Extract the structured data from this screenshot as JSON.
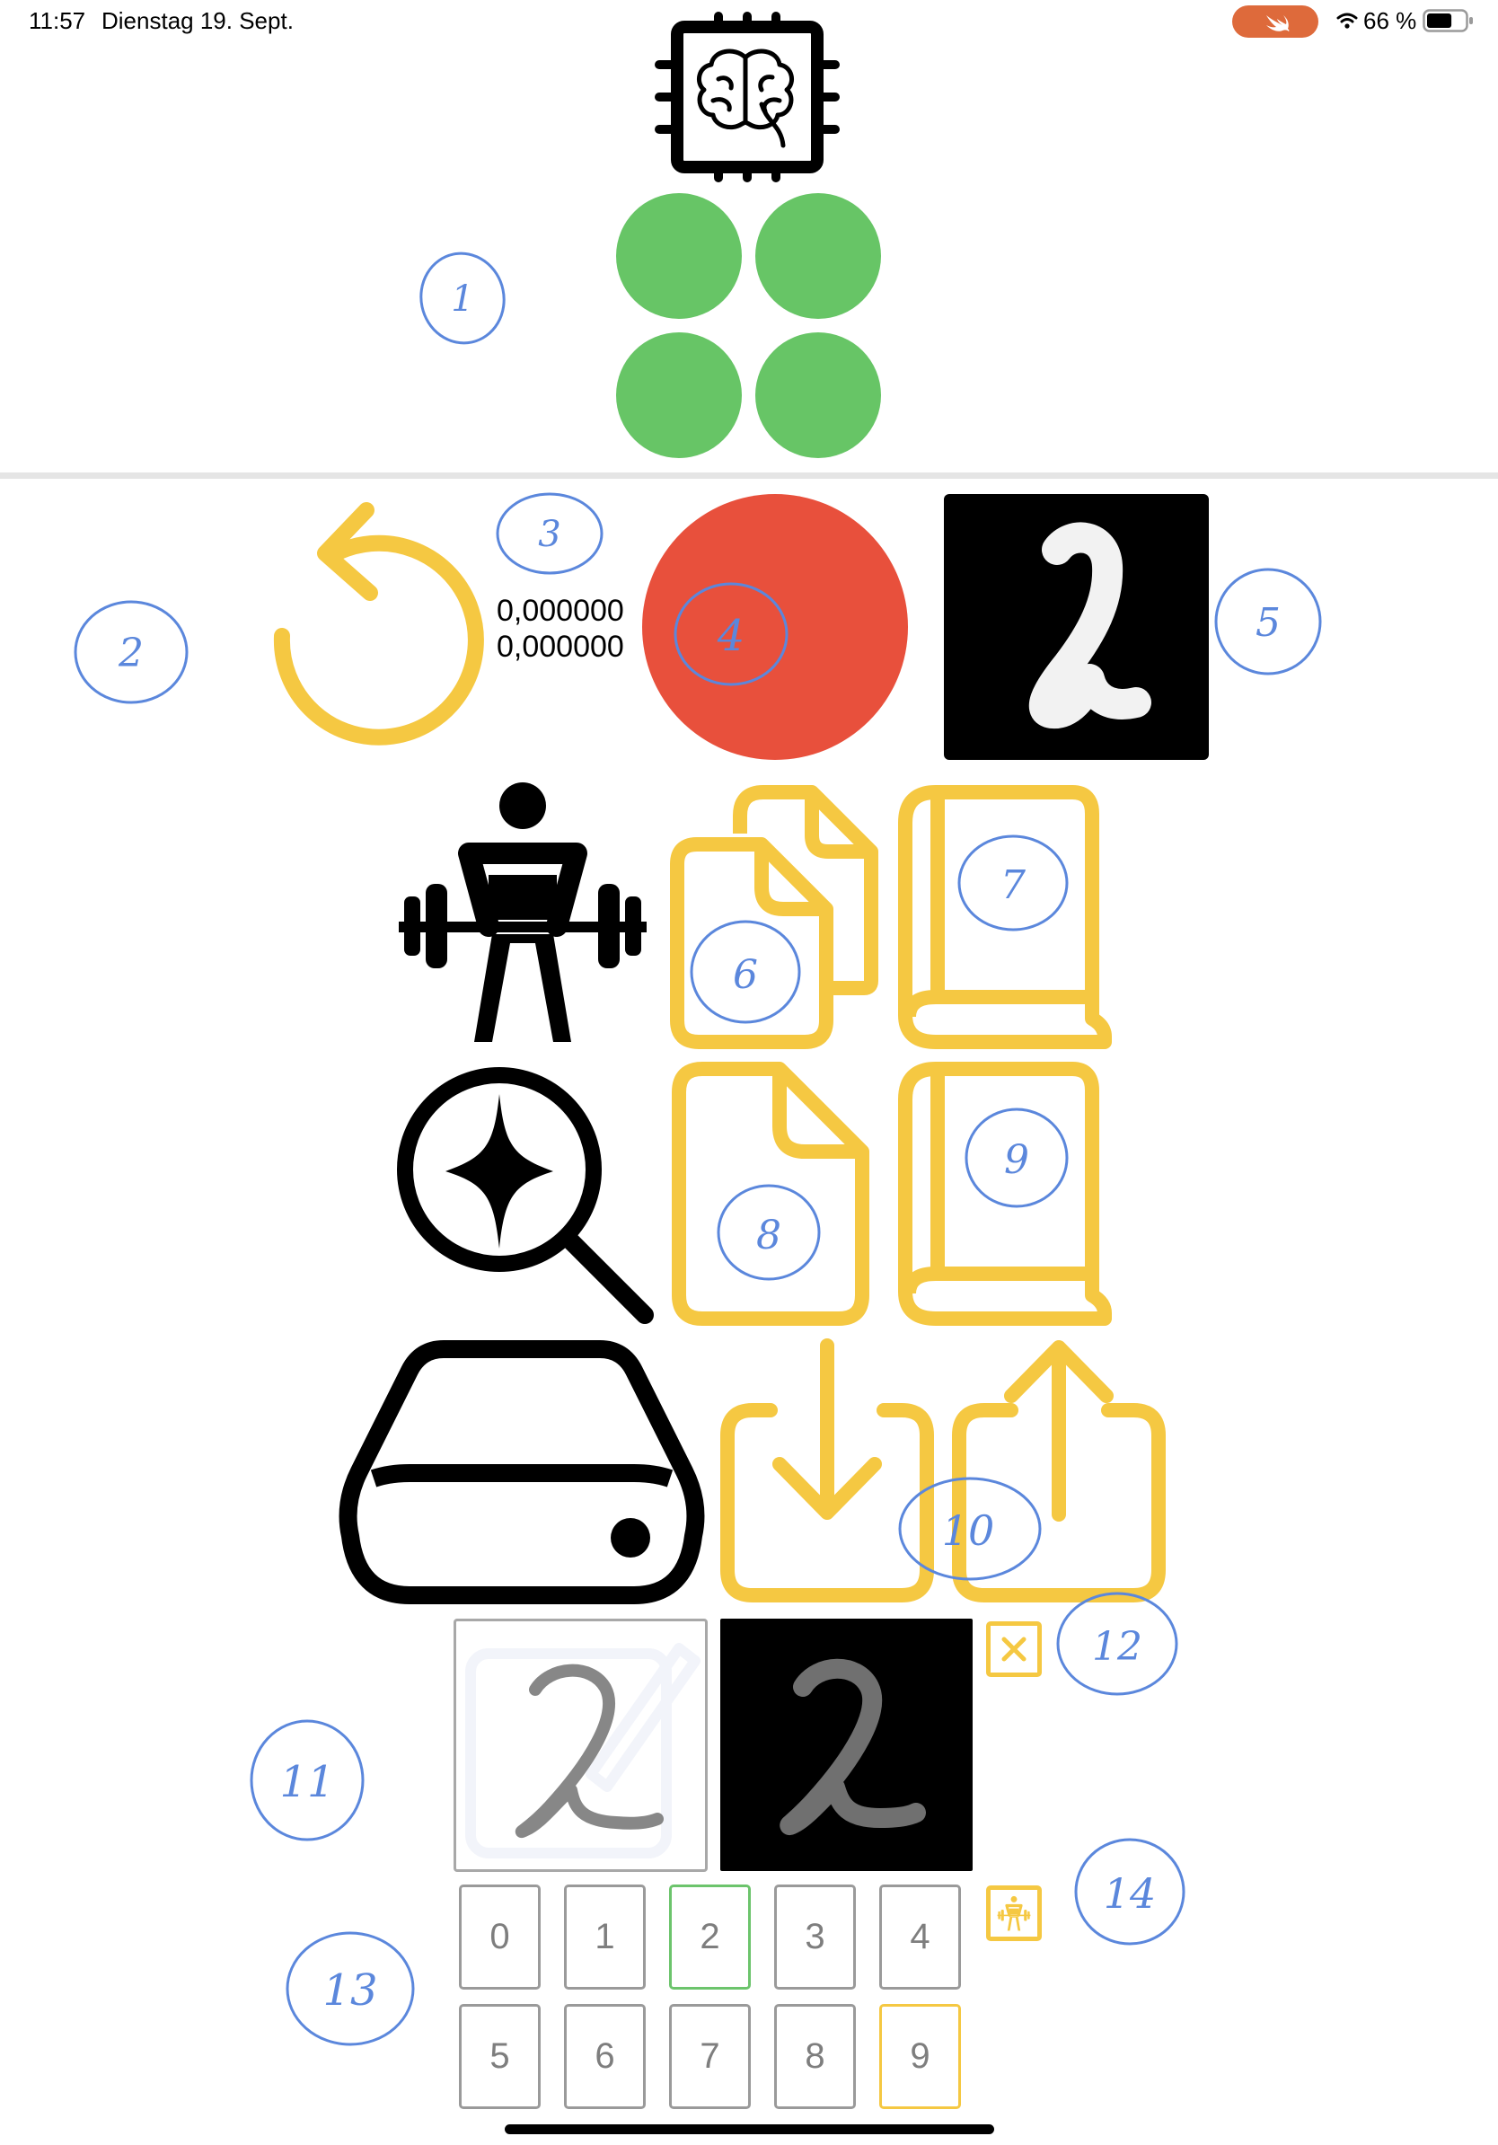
{
  "status_bar": {
    "time": "11:57",
    "date": "Dienstag 19. Sept.",
    "battery_percent": "66 %",
    "battery_level": 0.66
  },
  "model_status": {
    "icon": "ai-chip-icon",
    "indicator_color": "#67c566"
  },
  "prediction": {
    "value_line1": "0,000000",
    "value_line2": "0,000000",
    "indicator_color": "#e8503c",
    "preview_digit": "2"
  },
  "actions": {
    "reset_icon": "arrow-counterclockwise-icon",
    "train_icon": "figure-strengthtraining-icon",
    "evaluate_icon": "magnifier-sparkle-icon",
    "storage_icon": "internal-drive-icon",
    "accent_color": "#f5c842"
  },
  "drawing": {
    "input_digit": "2",
    "processed_digit": "2"
  },
  "keypad": {
    "row1": [
      "0",
      "1",
      "2",
      "3",
      "4"
    ],
    "row2": [
      "5",
      "6",
      "7",
      "8",
      "9"
    ],
    "predicted_digit": "2",
    "target_digit": "9",
    "predicted_color": "#6cc46c",
    "target_color": "#f5c842"
  },
  "annotations": [
    "1",
    "2",
    "3",
    "4",
    "5",
    "6",
    "7",
    "8",
    "9",
    "10",
    "11",
    "12",
    "13",
    "14"
  ]
}
